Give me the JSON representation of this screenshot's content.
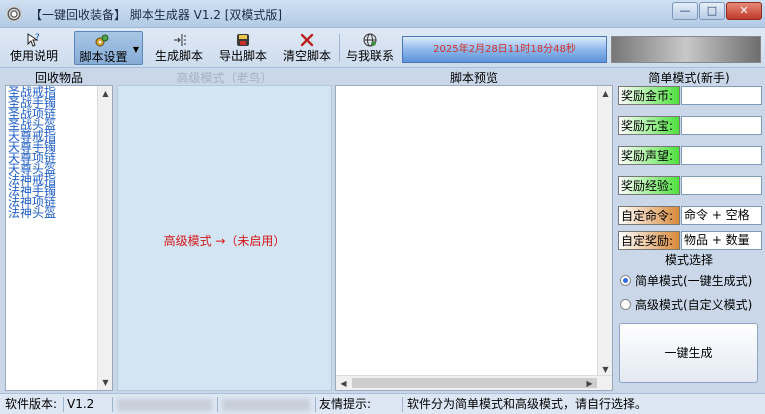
{
  "window": {
    "title": "【一键回收装备】 脚本生成器 V1.2 [双模式版]",
    "min_glyph": "—",
    "max_glyph": "□",
    "close_glyph": "✕"
  },
  "toolbar": {
    "help": "使用说明",
    "script_settings": "脚本设置",
    "generate": "生成脚本",
    "export": "导出脚本",
    "clear": "清空脚本",
    "contact": "与我联系",
    "datetime": "2025年2月28日11时18分48秒"
  },
  "recycle": {
    "header": "回收物品",
    "items": [
      "圣战戒指",
      "圣战手镯",
      "圣战项链",
      "圣战头盔",
      "天尊戒指",
      "天尊手镯",
      "天尊项链",
      "天尊头盔",
      "法神戒指",
      "法神手镯",
      "法神项链",
      "法神头盔"
    ]
  },
  "advanced": {
    "header": "高级模式（老鸟）",
    "status": "高级模式 →（未启用）"
  },
  "preview": {
    "header": "脚本预览"
  },
  "simple": {
    "header": "简单模式(新手)",
    "fields": [
      {
        "label": "奖励金币:",
        "value": ""
      },
      {
        "label": "奖励元宝:",
        "value": ""
      },
      {
        "label": "奖励声望:",
        "value": ""
      },
      {
        "label": "奖励经验:",
        "value": ""
      },
      {
        "label": "自定命令:",
        "value": "命令 + 空格"
      },
      {
        "label": "自定奖励:",
        "value": "物品 + 数量"
      }
    ]
  },
  "mode": {
    "header": "模式选择",
    "simple_option": "简单模式(一键生成式)",
    "advanced_option": "高级模式(自定义模式)",
    "selected": "simple",
    "generate_button": "一键生成"
  },
  "status": {
    "version_label": "软件版本:",
    "version": "V1.2",
    "tip_label": "友情提示:",
    "tip": "软件分为简单模式和高级模式，请自行选择。"
  },
  "colors": {
    "title_bg": "#c4d6ec",
    "date_text": "#d0332b",
    "list_text": "#1f5fc8",
    "advanced_text": "#d41616",
    "green_label": "#4fe03e",
    "orange_label": "#d88a3a"
  }
}
